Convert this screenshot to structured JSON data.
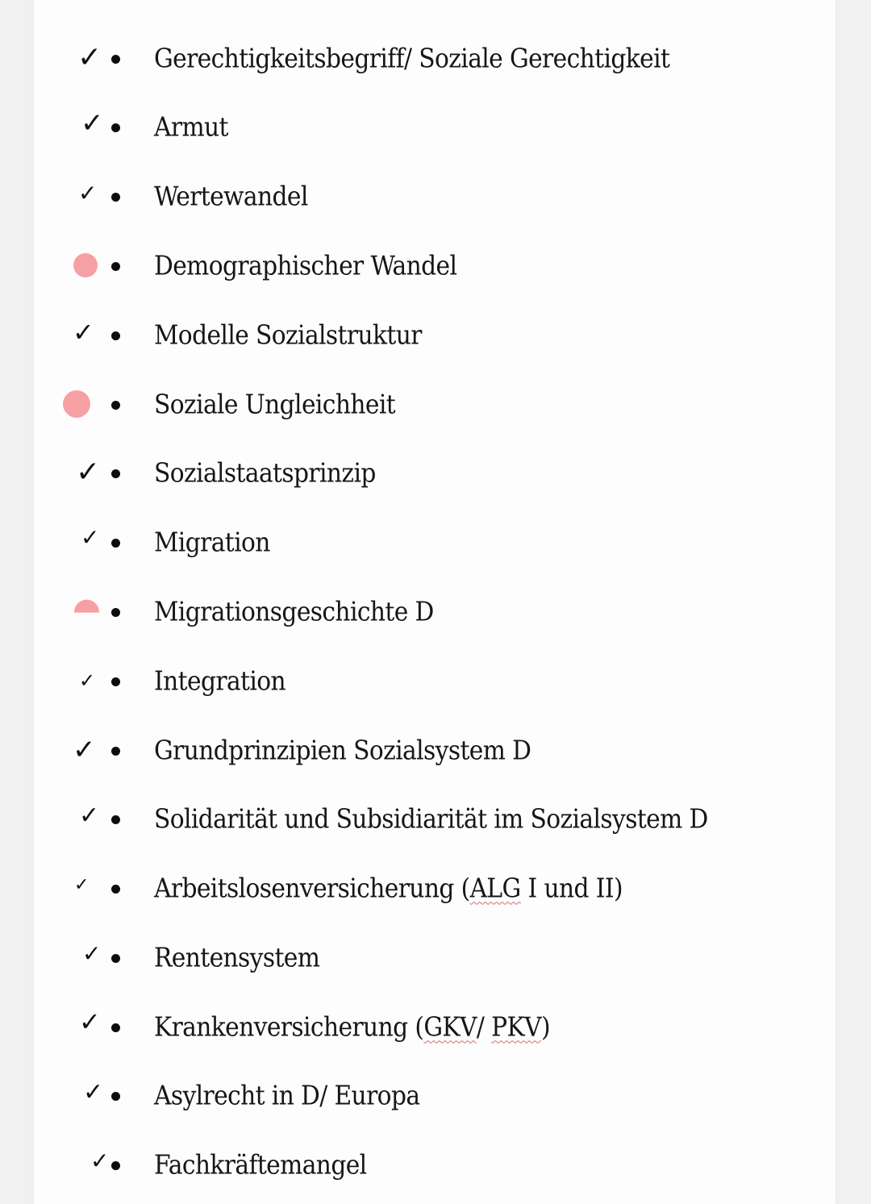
{
  "document": {
    "colors": {
      "pink_marker": "#f7a0a3",
      "text": "#161616",
      "page_background": "#fdfdfd",
      "outer_background": "#f1f1f1"
    },
    "items": [
      {
        "label": "Gerechtigkeitsbegriff/ Soziale Gerechtigkeit",
        "status": "checked",
        "status_icon": "checkmark-icon",
        "glyph": "✓"
      },
      {
        "label": "Armut",
        "status": "checked",
        "status_icon": "checkmark-icon",
        "glyph": "✓"
      },
      {
        "label": "Wertewandel",
        "status": "checked",
        "status_icon": "checkmark-icon",
        "glyph": "✓"
      },
      {
        "label": "Demographischer Wandel",
        "status": "open",
        "status_icon": "pink-circle-icon",
        "glyph": ""
      },
      {
        "label": "Modelle Sozialstruktur",
        "status": "checked",
        "status_icon": "checkmark-icon",
        "glyph": "✓"
      },
      {
        "label": "Soziale Ungleichheit",
        "status": "open",
        "status_icon": "pink-circle-icon",
        "glyph": ""
      },
      {
        "label": "Sozialstaatsprinzip",
        "status": "checked",
        "status_icon": "checkmark-icon",
        "glyph": "✓"
      },
      {
        "label": "Migration",
        "status": "checked",
        "status_icon": "checkmark-icon",
        "glyph": "✓"
      },
      {
        "label": "Migrationsgeschichte D",
        "status": "partial",
        "status_icon": "pink-half-circle-icon",
        "glyph": ""
      },
      {
        "label": "Integration",
        "status": "checked",
        "status_icon": "checkmark-icon",
        "glyph": "✓"
      },
      {
        "label": "Grundprinzipien Sozialsystem D",
        "status": "checked",
        "status_icon": "checkmark-icon",
        "glyph": "✓"
      },
      {
        "label": "Solidarität und Subsidiarität im Sozialsystem D",
        "status": "checked",
        "status_icon": "checkmark-icon",
        "glyph": "✓"
      },
      {
        "label_parts": [
          "Arbeitslosenversicherung (",
          "ALG",
          " I und II)"
        ],
        "label": "Arbeitslosenversicherung (ALG I und II)",
        "status": "checked",
        "status_icon": "checkmark-icon",
        "glyph": "✓"
      },
      {
        "label": "Rentensystem",
        "status": "checked",
        "status_icon": "checkmark-icon",
        "glyph": "✓"
      },
      {
        "label_parts": [
          "Krankenversicherung (",
          "GKV",
          "/ ",
          "PKV",
          ")"
        ],
        "label": "Krankenversicherung (GKV/ PKV)",
        "status": "checked",
        "status_icon": "checkmark-icon",
        "glyph": "✓"
      },
      {
        "label": "Asylrecht in D/ Europa",
        "status": "checked",
        "status_icon": "checkmark-icon",
        "glyph": "✓"
      },
      {
        "label": "Fachkräftemangel",
        "status": "checked",
        "status_icon": "checkmark-icon",
        "glyph": "✓"
      }
    ]
  }
}
